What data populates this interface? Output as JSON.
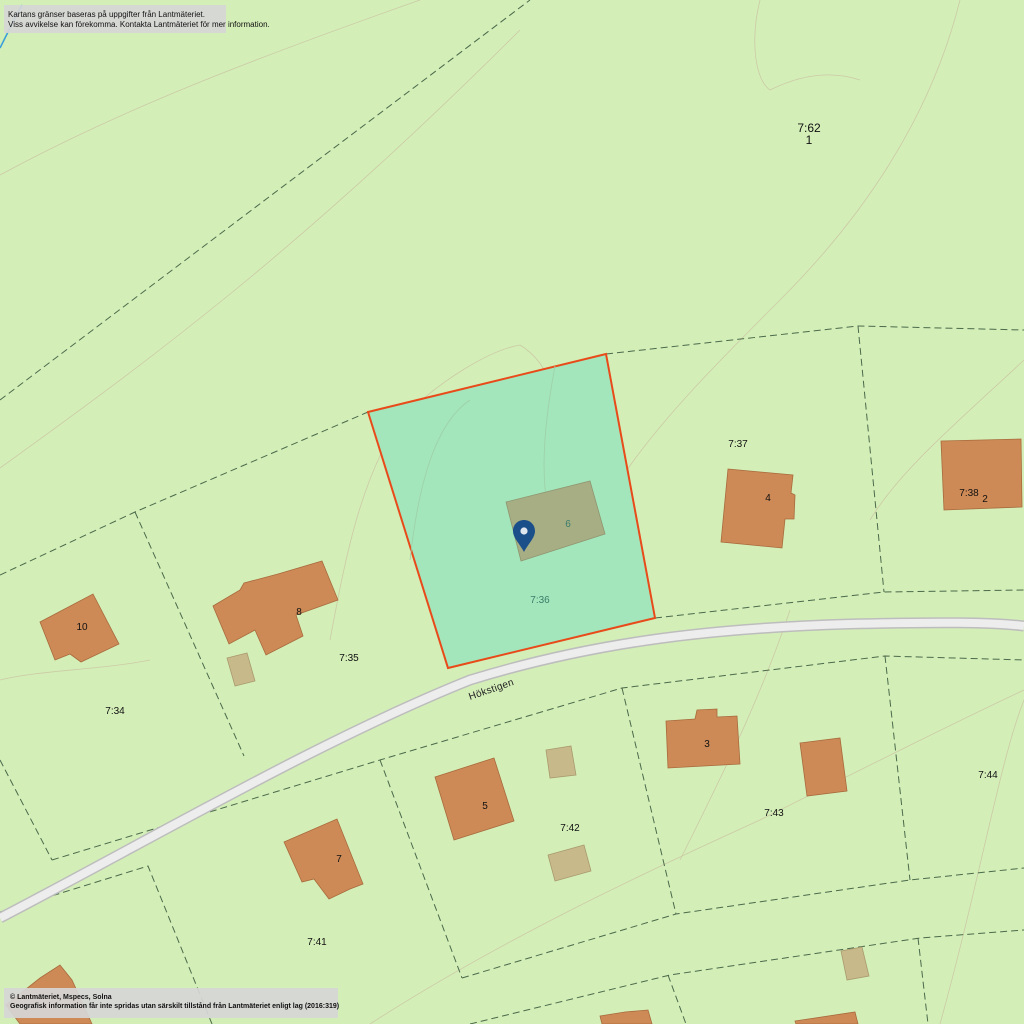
{
  "map": {
    "road_name": "Hökstigen",
    "selected_parcel": "7:36",
    "selected_building_number": "6",
    "parcels": [
      "7:62",
      "7:37",
      "7:38",
      "7:35",
      "7:34",
      "7:42",
      "7:43",
      "7:44",
      "7:41"
    ],
    "extra_label": "1",
    "building_numbers": [
      "4",
      "2",
      "10",
      "8",
      "3",
      "5",
      "7"
    ],
    "colors": {
      "background": "#d4eeb8",
      "selected_fill": "#a3e6bb",
      "selected_border": "#e84a1a",
      "building": "#cd8a56",
      "outbuilding": "#c8b98a",
      "marker": "#1b4f8a",
      "road": "#e8e8e8"
    }
  },
  "notices": {
    "top_line1": "Kartans gränser baseras på uppgifter från Lantmäteriet.",
    "top_line2": "Viss avvikelse kan förekomma. Kontakta Lantmäteriet för mer information.",
    "bottom_line1": "© Lantmäteriet, Mspecs, Solna",
    "bottom_line2": "Geografisk information får inte spridas utan särskilt tillstånd från Lantmäteriet enligt lag (2016:319)"
  },
  "icons": {
    "location_marker": "map-pin-icon"
  }
}
